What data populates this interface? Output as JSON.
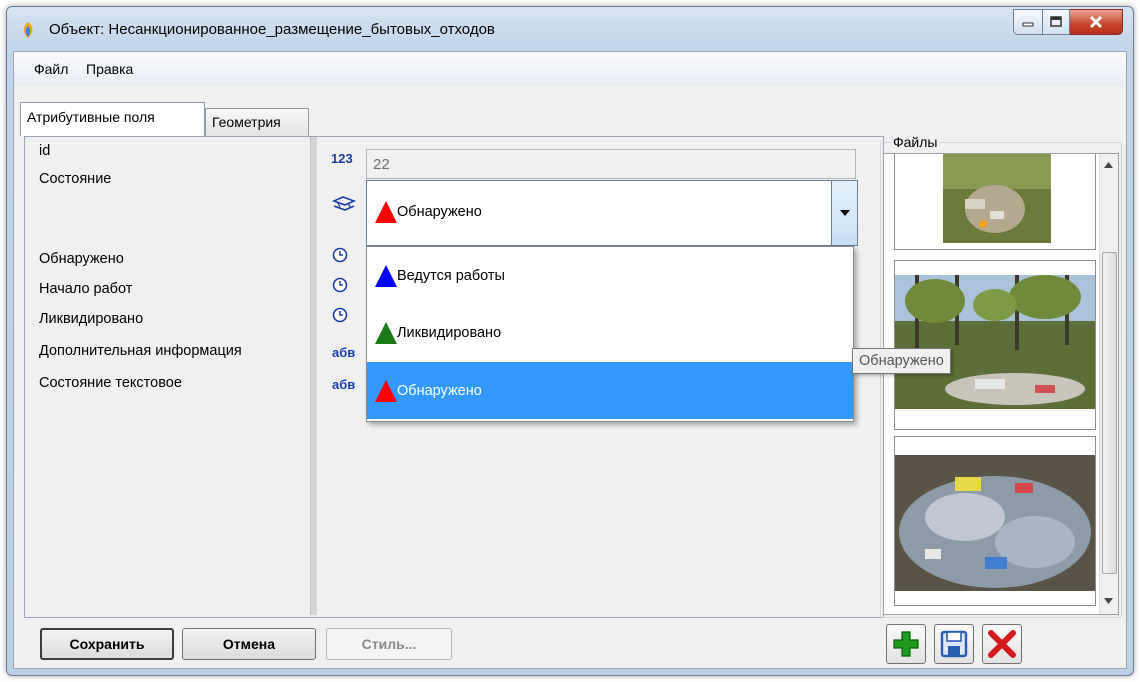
{
  "window": {
    "title": "Объект: Несанкционированное_размещение_бытовых_отходов"
  },
  "menu": {
    "items": [
      "Файл",
      "Правка"
    ]
  },
  "tabs": [
    {
      "label": "Атрибутивные поля",
      "active": true
    },
    {
      "label": "Геометрия",
      "active": false
    }
  ],
  "fields": [
    {
      "label": "id",
      "icon": "number-icon",
      "icon_text": "123"
    },
    {
      "label": "Состояние",
      "icon": "classifier-icon"
    },
    {
      "label": "Обнаружено",
      "icon": "clock-icon"
    },
    {
      "label": "Начало работ",
      "icon": "clock-icon"
    },
    {
      "label": "Ликвидировано",
      "icon": "clock-icon"
    },
    {
      "label": "Дополнительная информация",
      "icon": "text-icon",
      "icon_text": "абв"
    },
    {
      "label": "Состояние текстовое",
      "icon": "text-icon",
      "icon_text": "абв"
    }
  ],
  "id_value": "22",
  "state_combo": {
    "selected": "Обнаружено",
    "selected_color": "#ff0000",
    "options": [
      {
        "label": "Ведутся работы",
        "color": "#0000ff"
      },
      {
        "label": "Ликвидировано",
        "color": "#1a7a1a"
      },
      {
        "label": "Обнаружено",
        "color": "#ff0000",
        "highlighted": true
      }
    ]
  },
  "tooltip": "Обнаружено",
  "files": {
    "title": "Файлы",
    "thumbnails": [
      "photo-waste-forest-1",
      "photo-waste-forest-2",
      "photo-waste-pile-3"
    ]
  },
  "buttons": {
    "save": "Сохранить",
    "cancel": "Отмена",
    "style": "Стиль..."
  },
  "colors": {
    "selection": "#3399ff",
    "add_icon": "#1f9a1f",
    "save_icon": "#2a5db0",
    "delete_icon": "#d41a1a"
  }
}
